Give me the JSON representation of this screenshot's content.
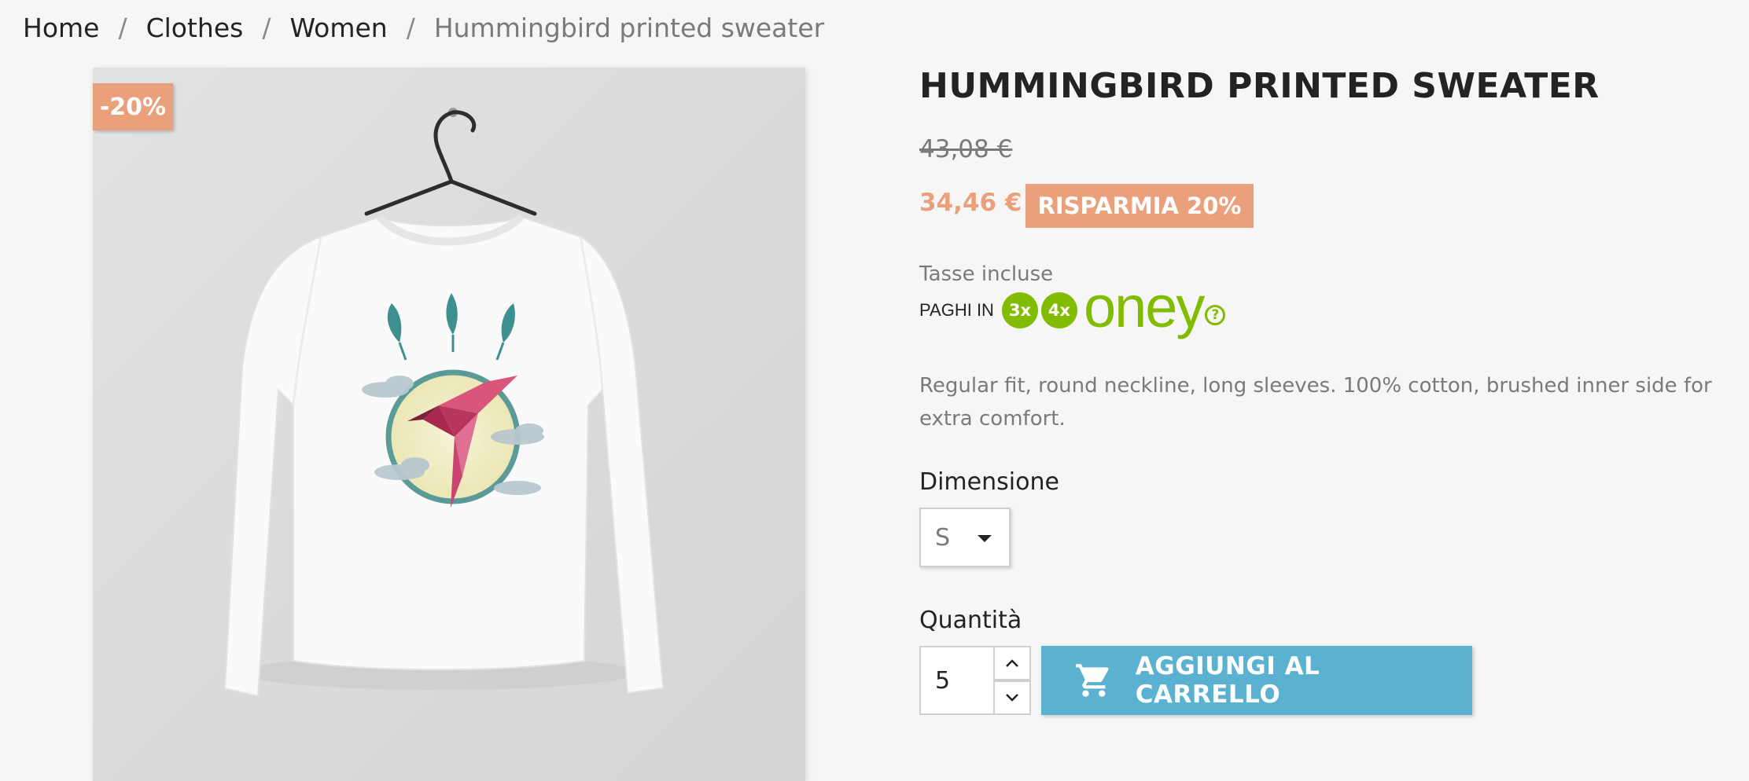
{
  "breadcrumb": {
    "items": [
      "Home",
      "Clothes",
      "Women"
    ],
    "current": "Hummingbird printed sweater",
    "separator": "/"
  },
  "product": {
    "name": "HUMMINGBIRD PRINTED SWEATER",
    "discount_flag": "-20%",
    "regular_price": "43,08 €",
    "price": "34,46 €",
    "save_badge": "RISPARMIA 20%",
    "tax_label": "Tasse incluse",
    "description": "Regular fit, round neckline, long sleeves. 100% cotton, brushed inner side for extra comfort."
  },
  "oney": {
    "prefix": "PAGHI IN",
    "option_3x": "3x",
    "option_4x": "4x",
    "brand": "oney",
    "help": "?",
    "help_icon": "question-circle-icon",
    "color": "#81bc00"
  },
  "size": {
    "label": "Dimensione",
    "selected": "S",
    "icon": "caret-down-icon"
  },
  "quantity": {
    "label": "Quantità",
    "value": "5",
    "up_icon": "chevron-up-icon",
    "down_icon": "chevron-down-icon"
  },
  "cart": {
    "button_label": "AGGIUNGI AL CARRELLO",
    "icon": "shopping-cart-icon",
    "color": "#5bb2d0"
  },
  "colors": {
    "accent": "#eba07c",
    "text": "#232323",
    "muted": "#7a7a7a",
    "background": "#f6f6f6"
  }
}
